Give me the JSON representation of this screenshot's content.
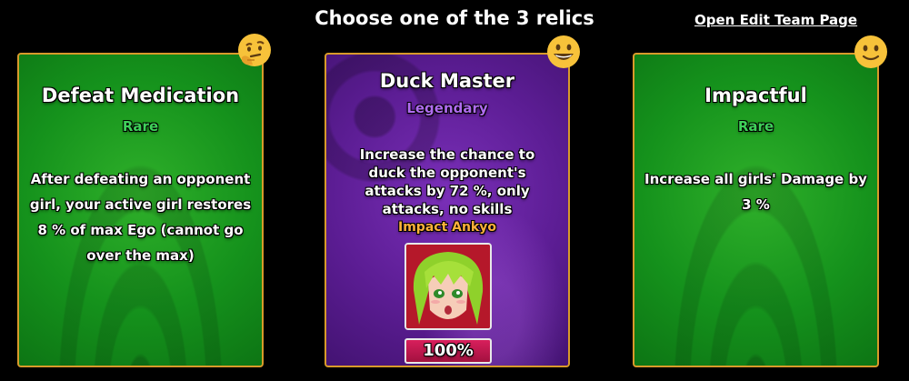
{
  "header": {
    "title": "Choose one of the 3 relics",
    "edit_link": "Open Edit Team Page"
  },
  "relics": [
    {
      "name": "Defeat Medication",
      "rarity": "Rare",
      "description": "After defeating an opponent girl, your active girl restores 8 % of max Ego (cannot go over the max)",
      "reaction_icon": "thinking-face-icon",
      "card_color": "#15921c"
    },
    {
      "name": "Duck Master",
      "rarity": "Legendary",
      "description": "Increase the chance to duck the opponent's attacks by 72 %, only attacks, no skills",
      "girl_name": "Impact Ankyo",
      "girl_percent": "100%",
      "reaction_icon": "grinning-face-icon",
      "card_color": "#5c1d94"
    },
    {
      "name": "Impactful",
      "rarity": "Rare",
      "description": "Increase all girls' Damage by 3 %",
      "reaction_icon": "slightly-smiling-face-icon",
      "card_color": "#15921c"
    }
  ],
  "colors": {
    "card_border": "#d89a2a",
    "rare_text": "#3fd15a",
    "legendary_text": "#b06cf0",
    "girl_name_text": "#ffb23a",
    "percent_bar": "#c4174e"
  }
}
